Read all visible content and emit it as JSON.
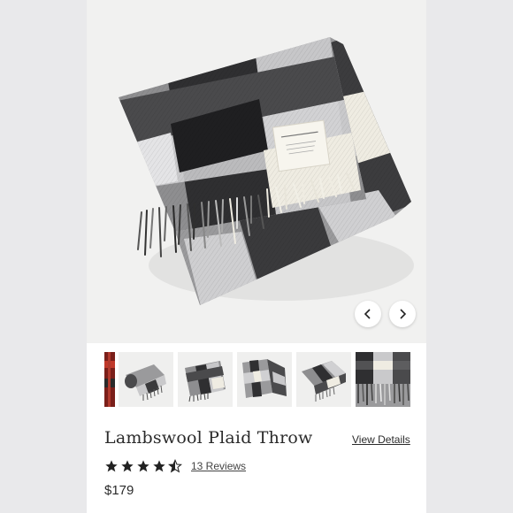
{
  "product": {
    "title": "Lambswool Plaid Throw",
    "view_details_label": "View Details",
    "rating": 4.5,
    "reviews_label": "13 Reviews",
    "price": "$179"
  },
  "gallery": {
    "main_image_icon": "plaid-throw-image",
    "prev_icon": "chevron-left-icon",
    "next_icon": "chevron-right-icon",
    "thumbnails": [
      {
        "icon": "red-plaid-thumbnail",
        "selected": false
      },
      {
        "icon": "rolled-throw-thumbnail",
        "selected": false
      },
      {
        "icon": "folded-throw-thumbnail",
        "selected": true
      },
      {
        "icon": "draped-throw-thumbnail",
        "selected": false
      },
      {
        "icon": "stacked-throw-thumbnail",
        "selected": false
      },
      {
        "icon": "fringe-closeup-thumbnail",
        "selected": false
      }
    ]
  },
  "colors": {
    "charcoal": "#3a3a3c",
    "mid_gray": "#8e8e90",
    "light_gray": "#c8c8ca",
    "cream": "#efece2",
    "text": "#2b2b2b"
  }
}
